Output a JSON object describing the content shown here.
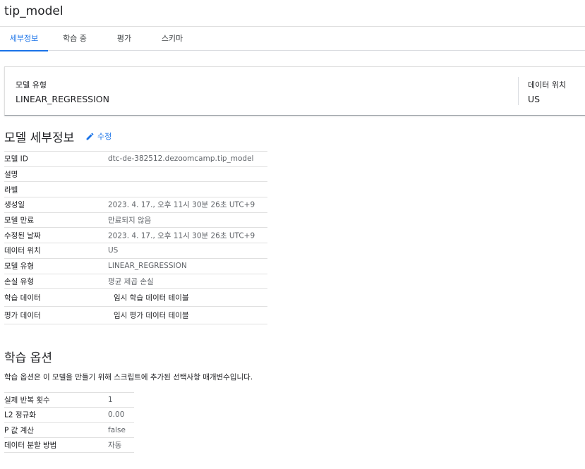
{
  "header": {
    "title": "tip_model"
  },
  "tabs": [
    {
      "label": "세부정보",
      "active": true
    },
    {
      "label": "학습 중",
      "active": false
    },
    {
      "label": "평가",
      "active": false
    },
    {
      "label": "스키마",
      "active": false
    }
  ],
  "summary": {
    "model_type_label": "모델 유형",
    "model_type_value": "LINEAR_REGRESSION",
    "location_label": "데이터 위치",
    "location_value": "US"
  },
  "details": {
    "heading": "모델 세부정보",
    "edit_label": "수정",
    "rows": [
      {
        "key": "모델 ID",
        "value": "dtc-de-382512.dezoomcamp.tip_model"
      },
      {
        "key": "설명",
        "value": ""
      },
      {
        "key": "라벨",
        "value": ""
      },
      {
        "key": "생성일",
        "value": "2023. 4. 17., 오후 11시 30분 26초 UTC+9"
      },
      {
        "key": "모델 만료",
        "value": "만료되지 않음"
      },
      {
        "key": "수정된 날짜",
        "value": "2023. 4. 17., 오후 11시 30분 26초 UTC+9"
      },
      {
        "key": "데이터 위치",
        "value": "US"
      },
      {
        "key": "모델 유형",
        "value": "LINEAR_REGRESSION"
      },
      {
        "key": "손실 유형",
        "value": "평균 제곱 손실"
      },
      {
        "key": "학습 데이터",
        "value": "임시 학습 데이터 테이블"
      },
      {
        "key": "평가 데이터",
        "value": "임시 평가 데이터 테이블"
      }
    ]
  },
  "training_options": {
    "heading": "학습 옵션",
    "description": "학습 옵션은 이 모델을 만들기 위해 스크립트에 추가된 선택사항 매개변수입니다.",
    "rows": [
      {
        "key": "실제 반복 횟수",
        "value": "1"
      },
      {
        "key": "L2 정규화",
        "value": "0.00"
      },
      {
        "key": "P 값 계산",
        "value": "false"
      },
      {
        "key": "데이터 분할 방법",
        "value": "자동"
      }
    ]
  },
  "colors": {
    "accent": "#1a73e8",
    "text": "#202124",
    "muted": "#5f6368",
    "border": "#e0e0e0"
  },
  "icons": {
    "edit": "pencil-icon"
  }
}
